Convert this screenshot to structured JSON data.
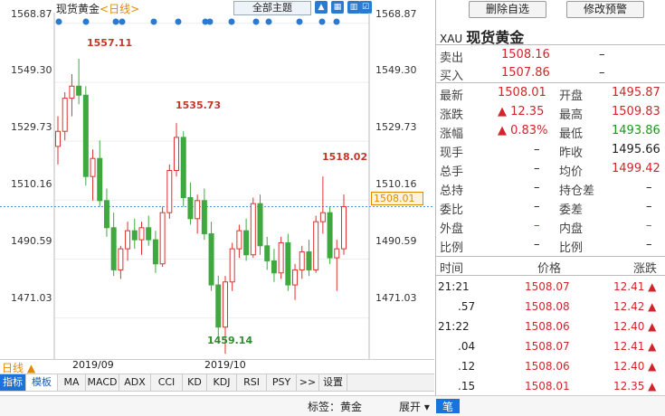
{
  "chart": {
    "symbol": "现货黄金",
    "timeframe": "<日线>",
    "theme_dropdown": "全部主题",
    "current_price_tag": "1508.01",
    "y_labels": [
      "1568.87",
      "1549.30",
      "1529.73",
      "1510.16",
      "1490.59",
      "1471.03"
    ],
    "annotations": {
      "high1": "1557.11",
      "high2": "1535.73",
      "high3": "1518.02",
      "low1": "1459.14"
    },
    "period_tab": "日线 ▲",
    "months": [
      "2019/09",
      "2019/10"
    ],
    "indicators": [
      "指标",
      "模板",
      "MA",
      "MACD",
      "ADX",
      "CCI",
      "KD",
      "KDJ",
      "RSI",
      "PSY",
      ">>",
      "设置"
    ],
    "colors": {
      "up": "#e03030",
      "down": "#3fa83f",
      "price_line": "#5a8fd8",
      "dot": "#2a7ad0"
    }
  },
  "chart_data": {
    "type": "candlestick",
    "y_range": [
      1455,
      1570
    ],
    "candles": [
      [
        1528,
        1538,
        1522,
        1533
      ],
      [
        1533,
        1546,
        1530,
        1544
      ],
      [
        1544,
        1552,
        1538,
        1548
      ],
      [
        1548,
        1557.11,
        1542,
        1545
      ],
      [
        1545,
        1548,
        1515,
        1518
      ],
      [
        1518,
        1527,
        1510,
        1524
      ],
      [
        1524,
        1530,
        1508,
        1510
      ],
      [
        1510,
        1514,
        1498,
        1501
      ],
      [
        1501,
        1506,
        1485,
        1487
      ],
      [
        1487,
        1495,
        1484,
        1494
      ],
      [
        1494,
        1503,
        1490,
        1500
      ],
      [
        1500,
        1504,
        1494,
        1497
      ],
      [
        1497,
        1503,
        1492,
        1501
      ],
      [
        1501,
        1505,
        1495,
        1497
      ],
      [
        1497,
        1500,
        1486,
        1489
      ],
      [
        1489,
        1508,
        1488,
        1506
      ],
      [
        1506,
        1522,
        1504,
        1520
      ],
      [
        1520,
        1535.73,
        1518,
        1531
      ],
      [
        1531,
        1533,
        1508,
        1511
      ],
      [
        1511,
        1516,
        1502,
        1504
      ],
      [
        1504,
        1512,
        1499,
        1510
      ],
      [
        1510,
        1514,
        1497,
        1499
      ],
      [
        1499,
        1503,
        1480,
        1482
      ],
      [
        1482,
        1485,
        1464,
        1468
      ],
      [
        1468,
        1485,
        1459.14,
        1483
      ],
      [
        1483,
        1496,
        1480,
        1494
      ],
      [
        1494,
        1502,
        1491,
        1500
      ],
      [
        1500,
        1504,
        1490,
        1492
      ],
      [
        1492,
        1511,
        1491,
        1509
      ],
      [
        1509,
        1512,
        1492,
        1495
      ],
      [
        1495,
        1498,
        1487,
        1490
      ],
      [
        1490,
        1494,
        1483,
        1486
      ],
      [
        1486,
        1498,
        1484,
        1496
      ],
      [
        1496,
        1499,
        1480,
        1482
      ],
      [
        1482,
        1489,
        1477,
        1487
      ],
      [
        1487,
        1495,
        1484,
        1493
      ],
      [
        1493,
        1497,
        1485,
        1487
      ],
      [
        1487,
        1505,
        1486,
        1503
      ],
      [
        1503,
        1518.02,
        1499,
        1506
      ],
      [
        1506,
        1508,
        1489,
        1491
      ],
      [
        1491,
        1497,
        1480,
        1494
      ],
      [
        1494,
        1512,
        1492,
        1508.01
      ]
    ]
  },
  "panel": {
    "delete_btn": "删除自选",
    "alert_btn": "修改预警",
    "code": "XAU",
    "name": "现货黄金",
    "sell_lbl": "卖出",
    "sell": "1508.16",
    "sell_vol": "–",
    "buy_lbl": "买入",
    "buy": "1507.86",
    "buy_vol": "–",
    "rows": [
      {
        "l1": "最新",
        "v1": "1508.01",
        "c1": "red",
        "l2": "开盘",
        "v2": "1495.87",
        "c2": "red"
      },
      {
        "l1": "涨跌",
        "v1": "▲ 12.35",
        "c1": "red",
        "l2": "最高",
        "v2": "1509.83",
        "c2": "red"
      },
      {
        "l1": "涨幅",
        "v1": "▲ 0.83%",
        "c1": "red",
        "l2": "最低",
        "v2": "1493.86",
        "c2": "green"
      },
      {
        "l1": "现手",
        "v1": "–",
        "c1": "",
        "l2": "昨收",
        "v2": "1495.66",
        "c2": ""
      },
      {
        "l1": "总手",
        "v1": "–",
        "c1": "",
        "l2": "均价",
        "v2": "1499.42",
        "c2": "red"
      },
      {
        "l1": "总持",
        "v1": "–",
        "c1": "",
        "l2": "持仓差",
        "v2": "–",
        "c2": ""
      },
      {
        "l1": "委比",
        "v1": "–",
        "c1": "",
        "l2": "委差",
        "v2": "–",
        "c2": ""
      },
      {
        "l1": "外盘",
        "v1": "–",
        "c1": "red",
        "l2": "内盘",
        "v2": "–",
        "c2": "green"
      },
      {
        "l1": "比例",
        "v1": "–",
        "c1": "",
        "l2": "比例",
        "v2": "–",
        "c2": ""
      }
    ],
    "trade_headers": [
      "时间",
      "价格",
      "涨跌"
    ],
    "trades": [
      {
        "t": "21:21",
        "p": "1508.07",
        "d": "12.41 ▲"
      },
      {
        "t": ".57",
        "p": "1508.08",
        "d": "12.42 ▲"
      },
      {
        "t": "21:22",
        "p": "1508.06",
        "d": "12.40 ▲"
      },
      {
        "t": ".04",
        "p": "1508.07",
        "d": "12.41 ▲"
      },
      {
        "t": ".12",
        "p": "1508.06",
        "d": "12.40 ▲"
      },
      {
        "t": ".15",
        "p": "1508.01",
        "d": "12.35 ▲"
      }
    ]
  },
  "status": {
    "tag": "标签：黄金",
    "expand": "展开 ▾",
    "pen": "笔"
  }
}
